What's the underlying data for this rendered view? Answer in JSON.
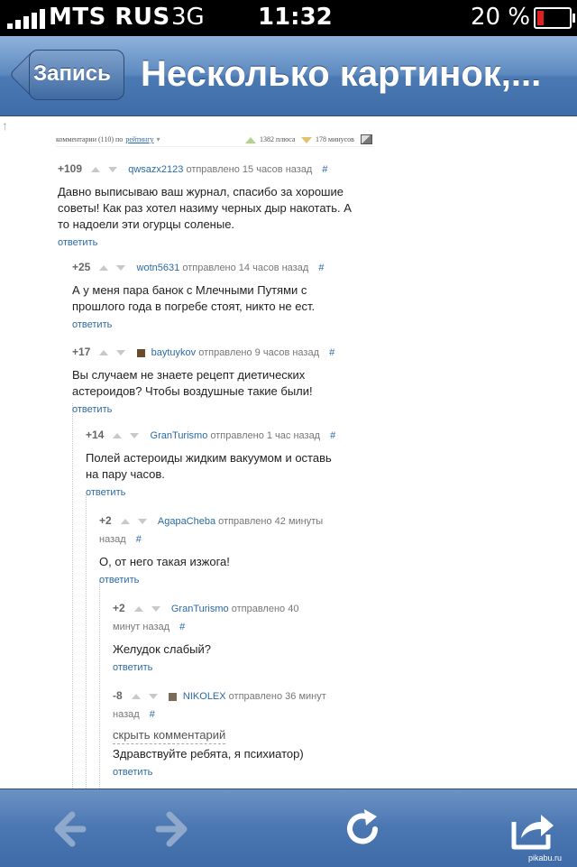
{
  "status_bar": {
    "carrier": "MTS RUS",
    "network": "3G",
    "time": "11:32",
    "battery": "20 %",
    "battery_level": 0.2,
    "battery_color": "#e02020"
  },
  "nav": {
    "back_label": "Запись",
    "title": "Несколько картинок,..."
  },
  "page_header": {
    "comments_prefix": "комментарии (110) по",
    "sort_label": "рейтингу",
    "sort_arrow": "▾",
    "pluses": "1382 плюса",
    "minuses": "178 минусов",
    "image_icon": "image-icon"
  },
  "comments": [
    {
      "score": "+109",
      "author": "qwsazx2123",
      "time": "отправлено 15 часов назад",
      "hash": "#",
      "text": "Давно выписываю ваш журнал, спасибо за хорошие советы! Как раз хотел назиму черных дыр накотать. А то надоели эти огурцы соленые.",
      "reply": "ответить"
    },
    {
      "score": "+25",
      "author": "wotn5631",
      "time": "отправлено 14 часов назад",
      "hash": "#",
      "text": "А у меня пара банок с Млечными Путями с прошлого года в погребе стоят, никто не ест.",
      "reply": "ответить"
    },
    {
      "score": "+17",
      "author": "baytuykov",
      "time": "отправлено 9 часов назад",
      "hash": "#",
      "text": "Вы случаем не знаете рецепт диетических астероидов? Чтобы воздушные такие были!",
      "reply": "ответить"
    },
    {
      "score": "+14",
      "author": "GranTurismo",
      "time": "отправлено 1 час назад",
      "hash": "#",
      "text": "Полей астероиды жидким вакуумом и оставь на пару часов.",
      "reply": "ответить"
    },
    {
      "score": "+2",
      "author": "AgapaCheba",
      "time_line1": "отправлено 42 минуты",
      "time_line2": "назад",
      "hash": "#",
      "text": "О, от него такая изжога!",
      "reply": "ответить"
    },
    {
      "score": "+2",
      "author": "GranTurismo",
      "time_line1": "отправлено 40",
      "time_line2": "минут назад",
      "hash": "#",
      "text": "Желудок слабый?",
      "reply": "ответить"
    },
    {
      "score": "-8",
      "author": "NIKOLEX",
      "time_line1": "отправлено 36 минут",
      "time_line2": "назад",
      "hash": "#",
      "hide": "скрыть комментарий",
      "text": "Здравствуйте ребята, я психиатор)",
      "reply": "ответить"
    }
  ],
  "toolbar": {
    "back_icon": "arrow-left-icon",
    "forward_icon": "arrow-right-icon",
    "reload_icon": "reload-icon",
    "share_icon": "share-icon"
  },
  "watermark": "pikabu.ru"
}
